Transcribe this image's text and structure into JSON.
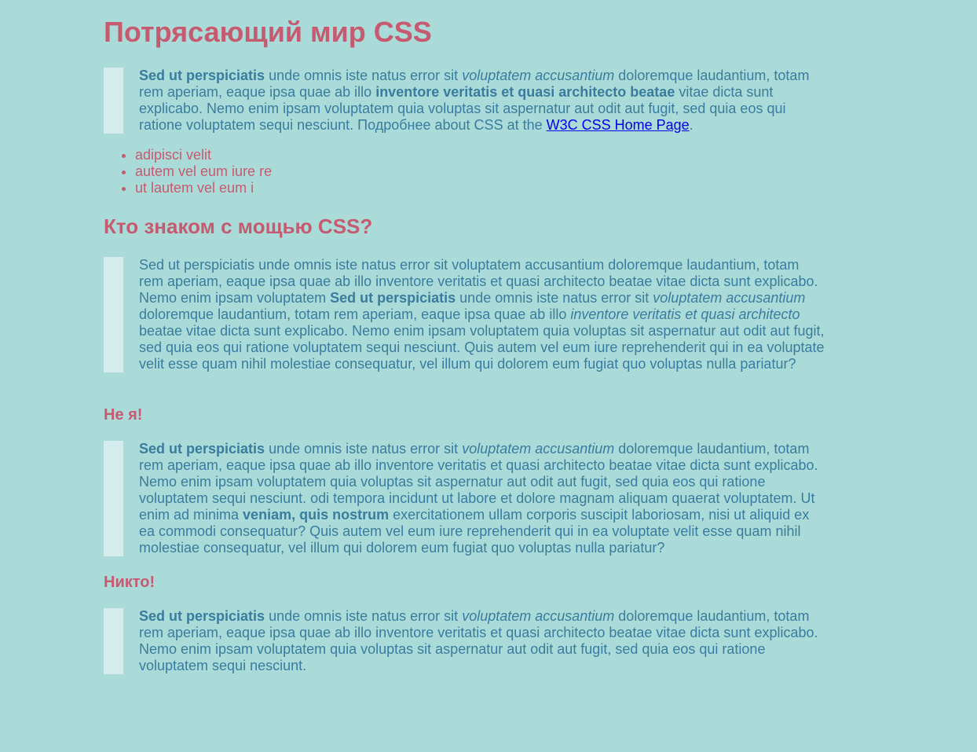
{
  "heading_main": "Потрясающий мир CSS",
  "quote1": {
    "b1": "Sed ut perspiciatis",
    "t1": " unde omnis iste natus error sit ",
    "i1": "voluptatem accusantium",
    "t2": " doloremque laudantium, totam rem aperiam, eaque ipsa quae ab illo ",
    "b2": "inventore veritatis et quasi architecto beatae",
    "t3": " vitae dicta sunt explicabo. Nemo enim ipsam voluptatem quia voluptas sit aspernatur aut odit aut fugit, sed quia eos qui ratione voluptatem sequi nesciunt. Подробнее about CSS at the ",
    "link": "W3C CSS Home Page",
    "t4": "."
  },
  "list_items": [
    "adipisci velit",
    "autem vel eum iure re",
    "ut lautem vel eum i"
  ],
  "heading_who": "Кто знаком с мощью CSS?",
  "quote2": {
    "t1": "Sed ut perspiciatis unde omnis iste natus error sit voluptatem accusantium doloremque laudantium, totam rem aperiam, eaque ipsa quae ab illo inventore veritatis et quasi architecto beatae vitae dicta sunt explicabo. Nemo enim ipsam voluptatem ",
    "b1": "Sed ut perspiciatis",
    "t2": " unde omnis iste natus error sit ",
    "i1": "voluptatem accusantium",
    "t3": " doloremque laudantium, totam rem aperiam, eaque ipsa quae ab illo ",
    "i2": "inventore veritatis et quasi architecto",
    "t4": " beatae vitae dicta sunt explicabo. Nemo enim ipsam voluptatem quia voluptas sit aspernatur aut odit aut fugit, sed quia eos qui ratione voluptatem sequi nesciunt. Quis autem vel eum iure reprehenderit qui in ea voluptate velit esse quam nihil molestiae consequatur, vel illum qui dolorem eum fugiat quo voluptas nulla pariatur?"
  },
  "heading_not_me": "Не я!",
  "quote3": {
    "b1": "Sed ut perspiciatis",
    "t1": " unde omnis iste natus error sit ",
    "i1": "voluptatem accusantium",
    "t2": " doloremque laudantium, totam rem aperiam, eaque ipsa quae ab illo inventore veritatis et quasi architecto beatae vitae dicta sunt explicabo. Nemo enim ipsam voluptatem quia voluptas sit aspernatur aut odit aut fugit, sed quia eos qui ratione voluptatem sequi nesciunt. odi tempora incidunt ut labore et dolore magnam aliquam quaerat voluptatem. Ut enim ad minima ",
    "b2": "veniam, quis nostrum",
    "t3": " exercitationem ullam corporis suscipit laboriosam, nisi ut aliquid ex ea commodi consequatur? Quis autem vel eum iure reprehenderit qui in ea voluptate velit esse quam nihil molestiae consequatur, vel illum qui dolorem eum fugiat quo voluptas nulla pariatur?"
  },
  "heading_nobody": "Никто!",
  "quote4": {
    "b1": "Sed ut perspiciatis",
    "t1": " unde omnis iste natus error sit ",
    "i1": "voluptatem accusantium",
    "t2": " doloremque laudantium, totam rem aperiam, eaque ipsa quae ab illo inventore veritatis et quasi architecto beatae vitae dicta sunt explicabo. Nemo enim ipsam voluptatem quia voluptas sit aspernatur aut odit aut fugit, sed quia eos qui ratione voluptatem sequi nesciunt."
  },
  "colors": {
    "background": "#aadbd8",
    "heading": "#c65a70",
    "body_text": "#3a7c9e",
    "quote_bar": "#d4ecec",
    "link": "#0000ee"
  }
}
